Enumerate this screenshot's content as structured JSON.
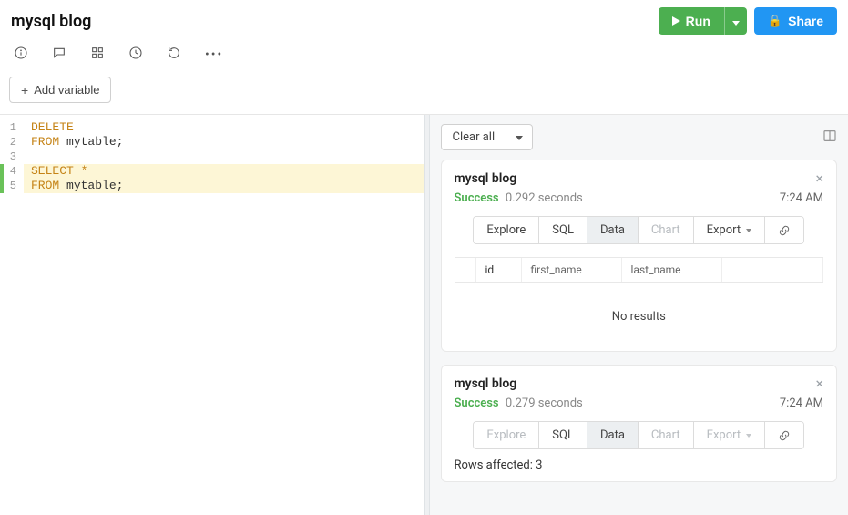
{
  "header": {
    "title": "mysql blog",
    "run_label": "Run",
    "share_label": "Share"
  },
  "toolbar": {
    "add_variable_label": "Add variable"
  },
  "editor": {
    "lines": [
      {
        "n": 1,
        "marker": "",
        "hl": false,
        "tokens": [
          [
            "kw",
            "DELETE"
          ]
        ]
      },
      {
        "n": 2,
        "marker": "",
        "hl": false,
        "tokens": [
          [
            "kw",
            "FROM"
          ],
          [
            "sp",
            " "
          ],
          [
            "id",
            "mytable;"
          ]
        ]
      },
      {
        "n": 3,
        "marker": "",
        "hl": false,
        "tokens": []
      },
      {
        "n": 4,
        "marker": "modified",
        "hl": true,
        "tokens": [
          [
            "kw",
            "SELECT"
          ],
          [
            "sp",
            " "
          ],
          [
            "op",
            "*"
          ]
        ]
      },
      {
        "n": 5,
        "marker": "modified",
        "hl": true,
        "tokens": [
          [
            "kw",
            "FROM"
          ],
          [
            "sp",
            " "
          ],
          [
            "id",
            "mytable;"
          ]
        ]
      }
    ]
  },
  "results": {
    "clear_all_label": "Clear all",
    "cards": [
      {
        "title": "mysql blog",
        "status": "Success",
        "seconds": "0.292 seconds",
        "timestamp": "7:24 AM",
        "tabs": {
          "explore": "Explore",
          "sql": "SQL",
          "data": "Data",
          "chart": "Chart",
          "export": "Export"
        },
        "active_tab": "Data",
        "explore_disabled": false,
        "columns": [
          "id",
          "first_name",
          "last_name"
        ],
        "no_results_label": "No results",
        "rows_affected_label": ""
      },
      {
        "title": "mysql blog",
        "status": "Success",
        "seconds": "0.279 seconds",
        "timestamp": "7:24 AM",
        "tabs": {
          "explore": "Explore",
          "sql": "SQL",
          "data": "Data",
          "chart": "Chart",
          "export": "Export"
        },
        "active_tab": "Data",
        "explore_disabled": true,
        "columns": [],
        "no_results_label": "",
        "rows_affected_label": "Rows affected: 3"
      }
    ]
  }
}
